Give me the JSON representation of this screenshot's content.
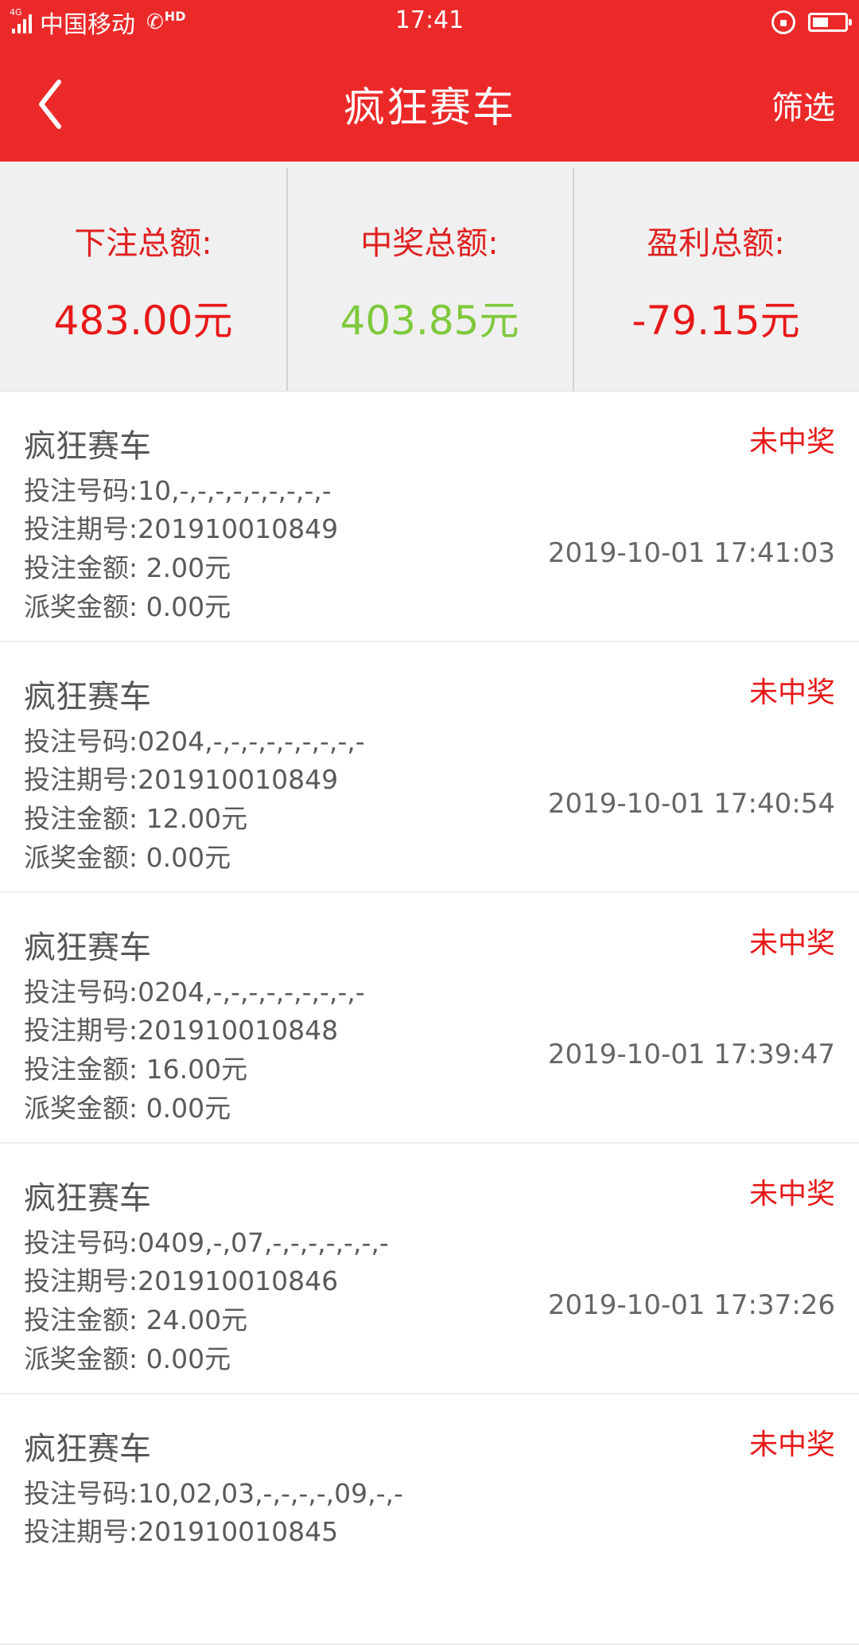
{
  "status_bar": {
    "network": "4G",
    "carrier": "中国移动",
    "hd": "HD",
    "time": "17:41",
    "battery_level": 0.5
  },
  "nav": {
    "title": "疯狂赛车",
    "filter_label": "筛选"
  },
  "summary": {
    "bet_total_label": "下注总额:",
    "bet_total_value": "483.00元",
    "win_total_label": "中奖总额:",
    "win_total_value": "403.85元",
    "profit_total_label": "盈利总额:",
    "profit_total_value": "-79.15元"
  },
  "colors": {
    "brand_red": "#ec2929",
    "value_red": "#e81818",
    "value_green": "#7ec93c"
  },
  "records": [
    {
      "game": "疯狂赛车",
      "numbers": "投注号码:10,-,-,-,-,-,-,-,-,-",
      "period": "投注期号:201910010849",
      "amount": "投注金额: 2.00元",
      "payout": "派奖金额: 0.00元",
      "status": "未中奖",
      "time": "2019-10-01 17:41:03"
    },
    {
      "game": "疯狂赛车",
      "numbers": "投注号码:0204,-,-,-,-,-,-,-,-,-",
      "period": "投注期号:201910010849",
      "amount": "投注金额: 12.00元",
      "payout": "派奖金额: 0.00元",
      "status": "未中奖",
      "time": "2019-10-01 17:40:54"
    },
    {
      "game": "疯狂赛车",
      "numbers": "投注号码:0204,-,-,-,-,-,-,-,-,-",
      "period": "投注期号:201910010848",
      "amount": "投注金额: 16.00元",
      "payout": "派奖金额: 0.00元",
      "status": "未中奖",
      "time": "2019-10-01 17:39:47"
    },
    {
      "game": "疯狂赛车",
      "numbers": "投注号码:0409,-,07,-,-,-,-,-,-,-",
      "period": "投注期号:201910010846",
      "amount": "投注金额: 24.00元",
      "payout": "派奖金额: 0.00元",
      "status": "未中奖",
      "time": "2019-10-01 17:37:26"
    },
    {
      "game": "疯狂赛车",
      "numbers": "投注号码:10,02,03,-,-,-,-,09,-,-",
      "period": "投注期号:201910010845",
      "amount": "",
      "payout": "",
      "status": "未中奖",
      "time": ""
    }
  ]
}
